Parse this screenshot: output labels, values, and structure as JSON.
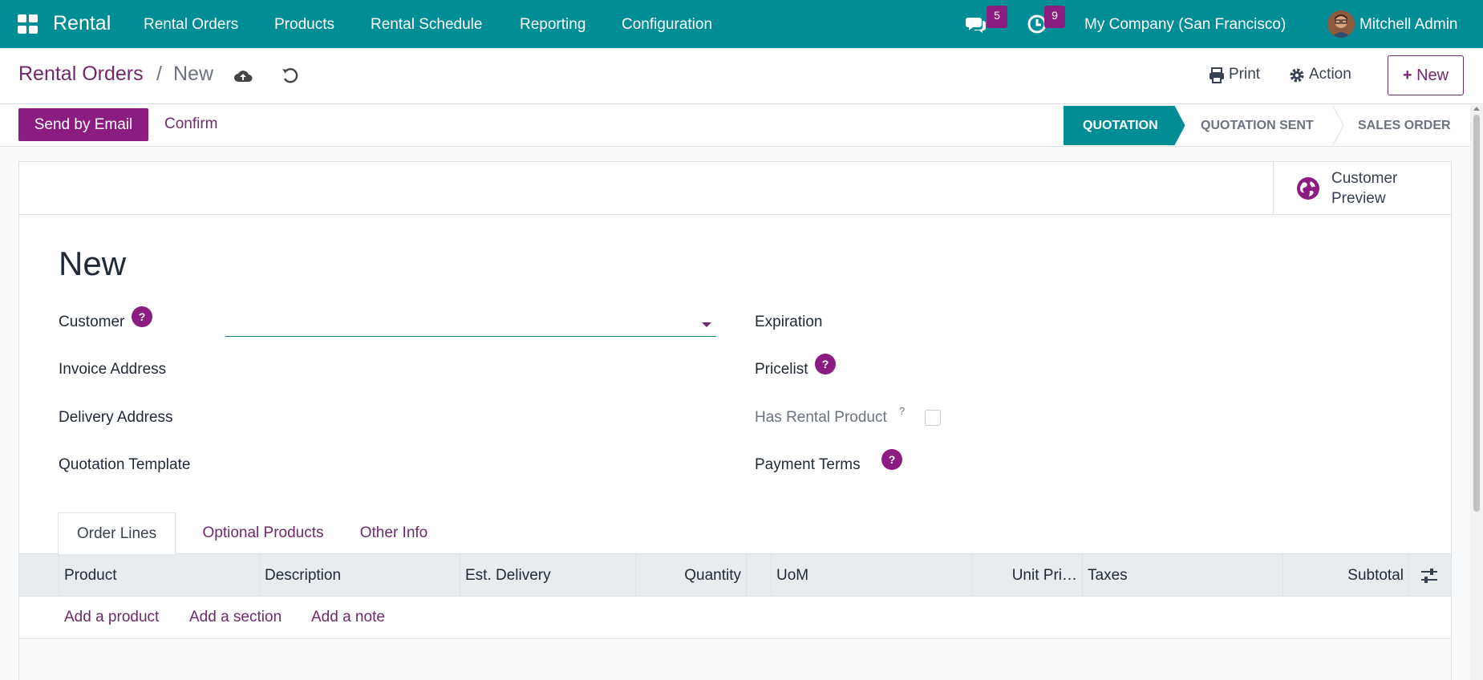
{
  "navbar": {
    "brand": "Rental",
    "menu": [
      "Rental Orders",
      "Products",
      "Rental Schedule",
      "Reporting",
      "Configuration"
    ],
    "messages_count": "5",
    "activities_count": "9",
    "company": "My Company (San Francisco)",
    "user": "Mitchell Admin"
  },
  "breadcrumb": {
    "parent": "Rental Orders",
    "separator": "/",
    "current": "New"
  },
  "control_panel": {
    "print_label": "Print",
    "action_label": "Action",
    "new_label": "New"
  },
  "statusbar": {
    "send_email_label": "Send by Email",
    "confirm_label": "Confirm",
    "stages": [
      "QUOTATION",
      "QUOTATION SENT",
      "SALES ORDER"
    ],
    "active_stage": "QUOTATION"
  },
  "button_box": {
    "preview_label_1": "Customer",
    "preview_label_2": "Preview"
  },
  "form": {
    "title": "New",
    "customer_label": "Customer",
    "customer_value": "",
    "invoice_address_label": "Invoice Address",
    "delivery_address_label": "Delivery Address",
    "quotation_template_label": "Quotation Template",
    "expiration_label": "Expiration",
    "pricelist_label": "Pricelist",
    "has_rental_label": "Has Rental Product",
    "has_rental_help": "?",
    "payment_terms_label": "Payment Terms",
    "help_mark": "?"
  },
  "tabs": [
    "Order Lines",
    "Optional Products",
    "Other Info"
  ],
  "order_lines": {
    "columns": [
      "Product",
      "Description",
      "Est. Delivery",
      "Quantity",
      "UoM",
      "Unit Pri…",
      "Taxes",
      "Subtotal"
    ],
    "add_product": "Add a product",
    "add_section": "Add a section",
    "add_note": "Add a note"
  },
  "colors": {
    "navbar": "#018d96",
    "primary": "#8b1d82",
    "link": "#71296c",
    "active_stage": "#018d96"
  }
}
